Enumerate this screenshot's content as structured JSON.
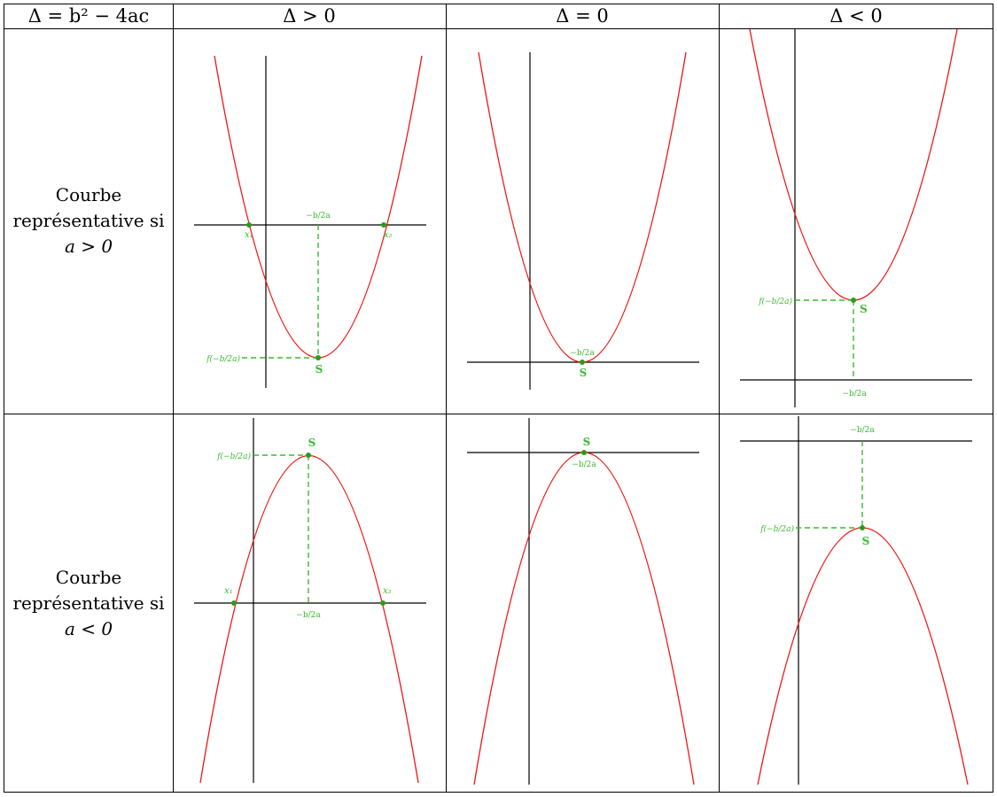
{
  "table": {
    "header": [
      "Δ = b² − 4ac",
      "Δ > 0",
      "Δ = 0",
      "Δ < 0"
    ],
    "rows": [
      {
        "label_lines": [
          "Courbe",
          "représentative si",
          "a > 0"
        ]
      },
      {
        "label_lines": [
          "Courbe",
          "représentative si",
          "a < 0"
        ]
      }
    ]
  },
  "labels": {
    "vertex": "S",
    "root_1": "x₁",
    "root_2": "x₂",
    "neg_b_over_2a": "−b/2a",
    "f_of_vertex": "f(−b/2a)"
  },
  "colors": {
    "curve": "#f01414",
    "annotation": "#3cb830",
    "point": "#2c9a1c",
    "line": "#000000"
  }
}
